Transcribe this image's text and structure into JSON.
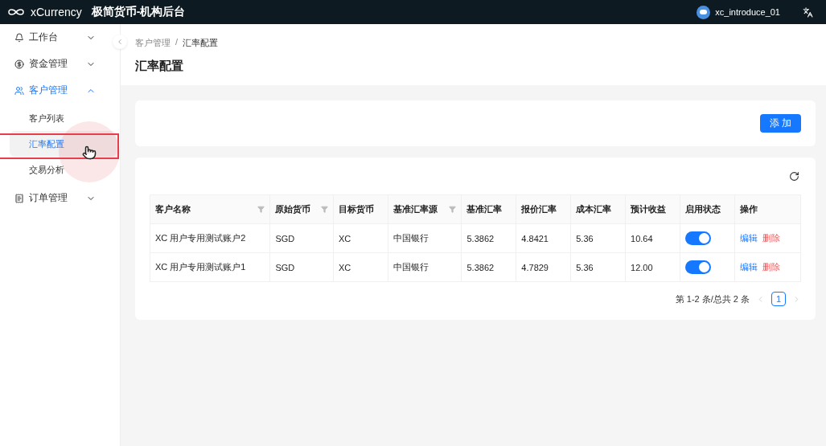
{
  "header": {
    "logo": "xCurrency",
    "title": "极简货币-机构后台",
    "user": "xc_introduce_01"
  },
  "sidebar": {
    "items": [
      {
        "label": "工作台",
        "expanded": false,
        "selected": false
      },
      {
        "label": "资金管理",
        "expanded": false,
        "selected": false
      },
      {
        "label": "客户管理",
        "expanded": true,
        "selected": true,
        "children": [
          {
            "label": "客户列表",
            "selected": false
          },
          {
            "label": "汇率配置",
            "selected": true
          },
          {
            "label": "交易分析",
            "selected": false
          }
        ]
      },
      {
        "label": "订单管理",
        "expanded": false,
        "selected": false
      }
    ]
  },
  "breadcrumb": {
    "items": [
      "客户管理",
      "汇率配置"
    ],
    "separator": "/"
  },
  "page_title": "汇率配置",
  "add_button": "添 加",
  "table": {
    "columns": [
      {
        "label": "客户名称",
        "filter": true
      },
      {
        "label": "原始货币",
        "filter": true
      },
      {
        "label": "目标货币",
        "filter": false
      },
      {
        "label": "基准汇率源",
        "filter": true
      },
      {
        "label": "基准汇率",
        "filter": false
      },
      {
        "label": "报价汇率",
        "filter": false
      },
      {
        "label": "成本汇率",
        "filter": false
      },
      {
        "label": "预计收益",
        "filter": false
      },
      {
        "label": "启用状态",
        "filter": false
      },
      {
        "label": "操作",
        "filter": false
      }
    ],
    "rows": [
      {
        "cells": [
          "XC 用户专用测试账户2",
          "SGD",
          "XC",
          "中国银行",
          "5.3862",
          "4.8421",
          "5.36",
          "10.64"
        ],
        "enabled": true,
        "actions": [
          "编辑",
          "删除"
        ]
      },
      {
        "cells": [
          "XC 用户专用测试账户1",
          "SGD",
          "XC",
          "中国银行",
          "5.3862",
          "4.7829",
          "5.36",
          "12.00"
        ],
        "enabled": true,
        "actions": [
          "编辑",
          "删除"
        ]
      }
    ]
  },
  "pagination": {
    "summary": "第 1-2 条/总共 2 条",
    "pages": [
      {
        "label": "1",
        "selected": true
      }
    ]
  }
}
